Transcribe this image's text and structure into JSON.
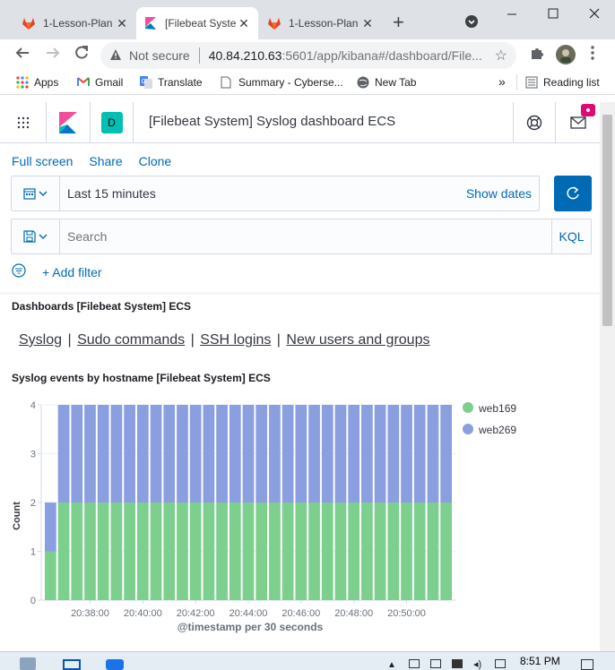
{
  "browser": {
    "tabs": [
      {
        "title": "1-Lesson-Plan",
        "active": false
      },
      {
        "title": "[Filebeat Syste",
        "active": true
      },
      {
        "title": "1-Lesson-Plan",
        "active": false
      }
    ],
    "new_tab_symbol": "+",
    "not_secure": "Not secure",
    "url_host": "40.84.210.63",
    "url_path": ":5601/app/kibana#/dashboard/File...",
    "bookmarks": [
      {
        "label": "Apps",
        "icon": "apps-grid-icon"
      },
      {
        "label": "Gmail",
        "icon": "gmail-icon"
      },
      {
        "label": "Translate",
        "icon": "translate-icon"
      },
      {
        "label": "Summary - Cyberse...",
        "icon": "doc-icon"
      },
      {
        "label": "New Tab",
        "icon": "globe-icon"
      }
    ],
    "more_bookmarks": "»",
    "reading_list": "Reading list"
  },
  "kibana": {
    "space_avatar": "D",
    "dashboard_title": "[Filebeat System] Syslog dashboard ECS",
    "nav": [
      "Full screen",
      "Share",
      "Clone"
    ],
    "time_range": "Last 15 minutes",
    "show_dates": "Show dates",
    "search_placeholder": "Search",
    "query_language": "KQL",
    "add_filter": "+ Add filter",
    "colors": {
      "accent": "#006bb4",
      "web169": "#7dcf8e",
      "web269": "#8a9ee0"
    }
  },
  "panels": {
    "nav_panel_title": "Dashboards [Filebeat System] ECS",
    "links": [
      "Syslog",
      "Sudo commands",
      "SSH logins",
      "New users and groups"
    ],
    "chart_panel_title": "Syslog events by hostname [Filebeat System] ECS"
  },
  "chart_data": {
    "type": "bar",
    "stacked": true,
    "xlabel": "@timestamp per 30 seconds",
    "ylabel": "Count",
    "ylim": [
      0,
      4
    ],
    "y_ticks": [
      "0",
      "1",
      "2",
      "3",
      "4"
    ],
    "x_ticks": [
      "20:38:00",
      "20:40:00",
      "20:42:00",
      "20:44:00",
      "20:46:00",
      "20:48:00",
      "20:50:00"
    ],
    "x_tick_bar_index": [
      3,
      7,
      11,
      15,
      19,
      23,
      27
    ],
    "series": [
      {
        "name": "web169",
        "color": "#7dcf8e",
        "values": [
          1,
          2,
          2,
          2,
          2,
          2,
          2,
          2,
          2,
          2,
          2,
          2,
          2,
          2,
          2,
          2,
          2,
          2,
          2,
          2,
          2,
          2,
          2,
          2,
          2,
          2,
          2,
          2,
          2,
          2,
          2
        ]
      },
      {
        "name": "web269",
        "color": "#8a9ee0",
        "values": [
          1,
          2,
          2,
          2,
          2,
          2,
          2,
          2,
          2,
          2,
          2,
          2,
          2,
          2,
          2,
          2,
          2,
          2,
          2,
          2,
          2,
          2,
          2,
          2,
          2,
          2,
          2,
          2,
          2,
          2,
          2
        ]
      }
    ],
    "legend_position": "right"
  },
  "taskbar": {
    "time": "8:51 PM"
  }
}
